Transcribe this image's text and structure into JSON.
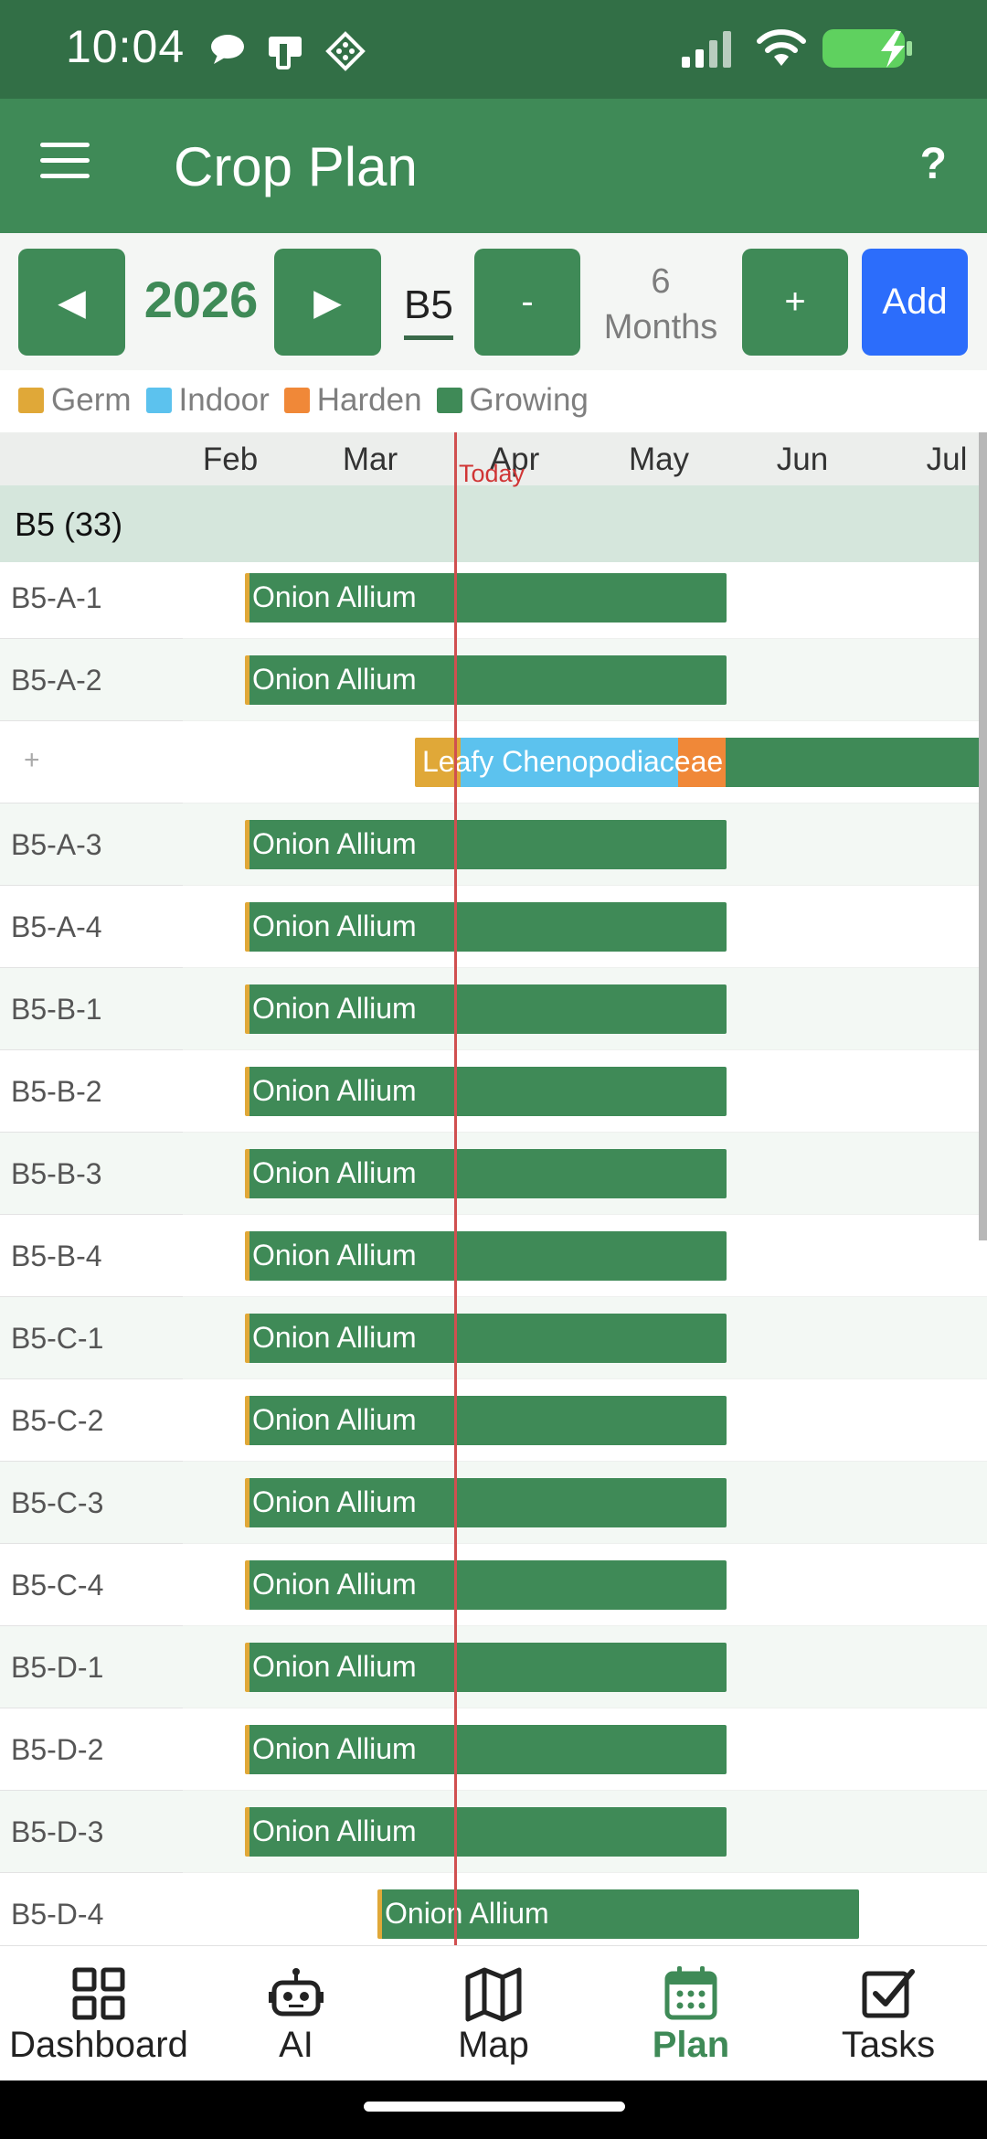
{
  "status_bar": {
    "time": "10:04",
    "notification_icons": [
      "chat-bubble-icon",
      "device-icon",
      "diamond-grid-icon"
    ],
    "signal_icon": "cellular-signal-icon",
    "wifi_icon": "wifi-icon",
    "battery_icon": "battery-charging-icon"
  },
  "app_bar": {
    "title": "Crop Plan",
    "menu_icon": "hamburger-menu-icon",
    "help_label": "?"
  },
  "controls": {
    "prev_label": "◀",
    "year": "2026",
    "next_label": "▶",
    "bed_value": "B5",
    "minus_label": "-",
    "range_number": "6",
    "range_unit": "Months",
    "plus_label": "+",
    "add_label": "Add"
  },
  "legend": [
    {
      "label": "Germ",
      "color": "#e0a838"
    },
    {
      "label": "Indoor",
      "color": "#5cc2ee"
    },
    {
      "label": "Harden",
      "color": "#f08838"
    },
    {
      "label": "Growing",
      "color": "#3f8a57"
    }
  ],
  "timeline": {
    "months": [
      "Feb",
      "Mar",
      "Apr",
      "May",
      "Jun",
      "Jul"
    ],
    "today_label": "Today",
    "group_label": "B5 (33)",
    "rows": [
      {
        "label": "B5-A-1",
        "crop": "Onion Allium",
        "timing": "early"
      },
      {
        "label": "B5-A-2",
        "crop": "Onion Allium",
        "timing": "early"
      },
      {
        "label": "+",
        "crop": "Leafy Chenopodiaceae",
        "timing": "leafy"
      },
      {
        "label": "B5-A-3",
        "crop": "Onion Allium",
        "timing": "early"
      },
      {
        "label": "B5-A-4",
        "crop": "Onion Allium",
        "timing": "early"
      },
      {
        "label": "B5-B-1",
        "crop": "Onion Allium",
        "timing": "early"
      },
      {
        "label": "B5-B-2",
        "crop": "Onion Allium",
        "timing": "early"
      },
      {
        "label": "B5-B-3",
        "crop": "Onion Allium",
        "timing": "early"
      },
      {
        "label": "B5-B-4",
        "crop": "Onion Allium",
        "timing": "early"
      },
      {
        "label": "B5-C-1",
        "crop": "Onion Allium",
        "timing": "early"
      },
      {
        "label": "B5-C-2",
        "crop": "Onion Allium",
        "timing": "early"
      },
      {
        "label": "B5-C-3",
        "crop": "Onion Allium",
        "timing": "early"
      },
      {
        "label": "B5-C-4",
        "crop": "Onion Allium",
        "timing": "early"
      },
      {
        "label": "B5-D-1",
        "crop": "Onion Allium",
        "timing": "early"
      },
      {
        "label": "B5-D-2",
        "crop": "Onion Allium",
        "timing": "early"
      },
      {
        "label": "B5-D-3",
        "crop": "Onion Allium",
        "timing": "early"
      },
      {
        "label": "B5-D-4",
        "crop": "Onion Allium",
        "timing": "late"
      }
    ]
  },
  "bottom_nav": [
    {
      "label": "Dashboard",
      "icon": "dashboard-grid-icon",
      "active": false
    },
    {
      "label": "AI",
      "icon": "robot-icon",
      "active": false
    },
    {
      "label": "Map",
      "icon": "map-icon",
      "active": false
    },
    {
      "label": "Plan",
      "icon": "calendar-icon",
      "active": true
    },
    {
      "label": "Tasks",
      "icon": "checkbox-icon",
      "active": false
    }
  ]
}
